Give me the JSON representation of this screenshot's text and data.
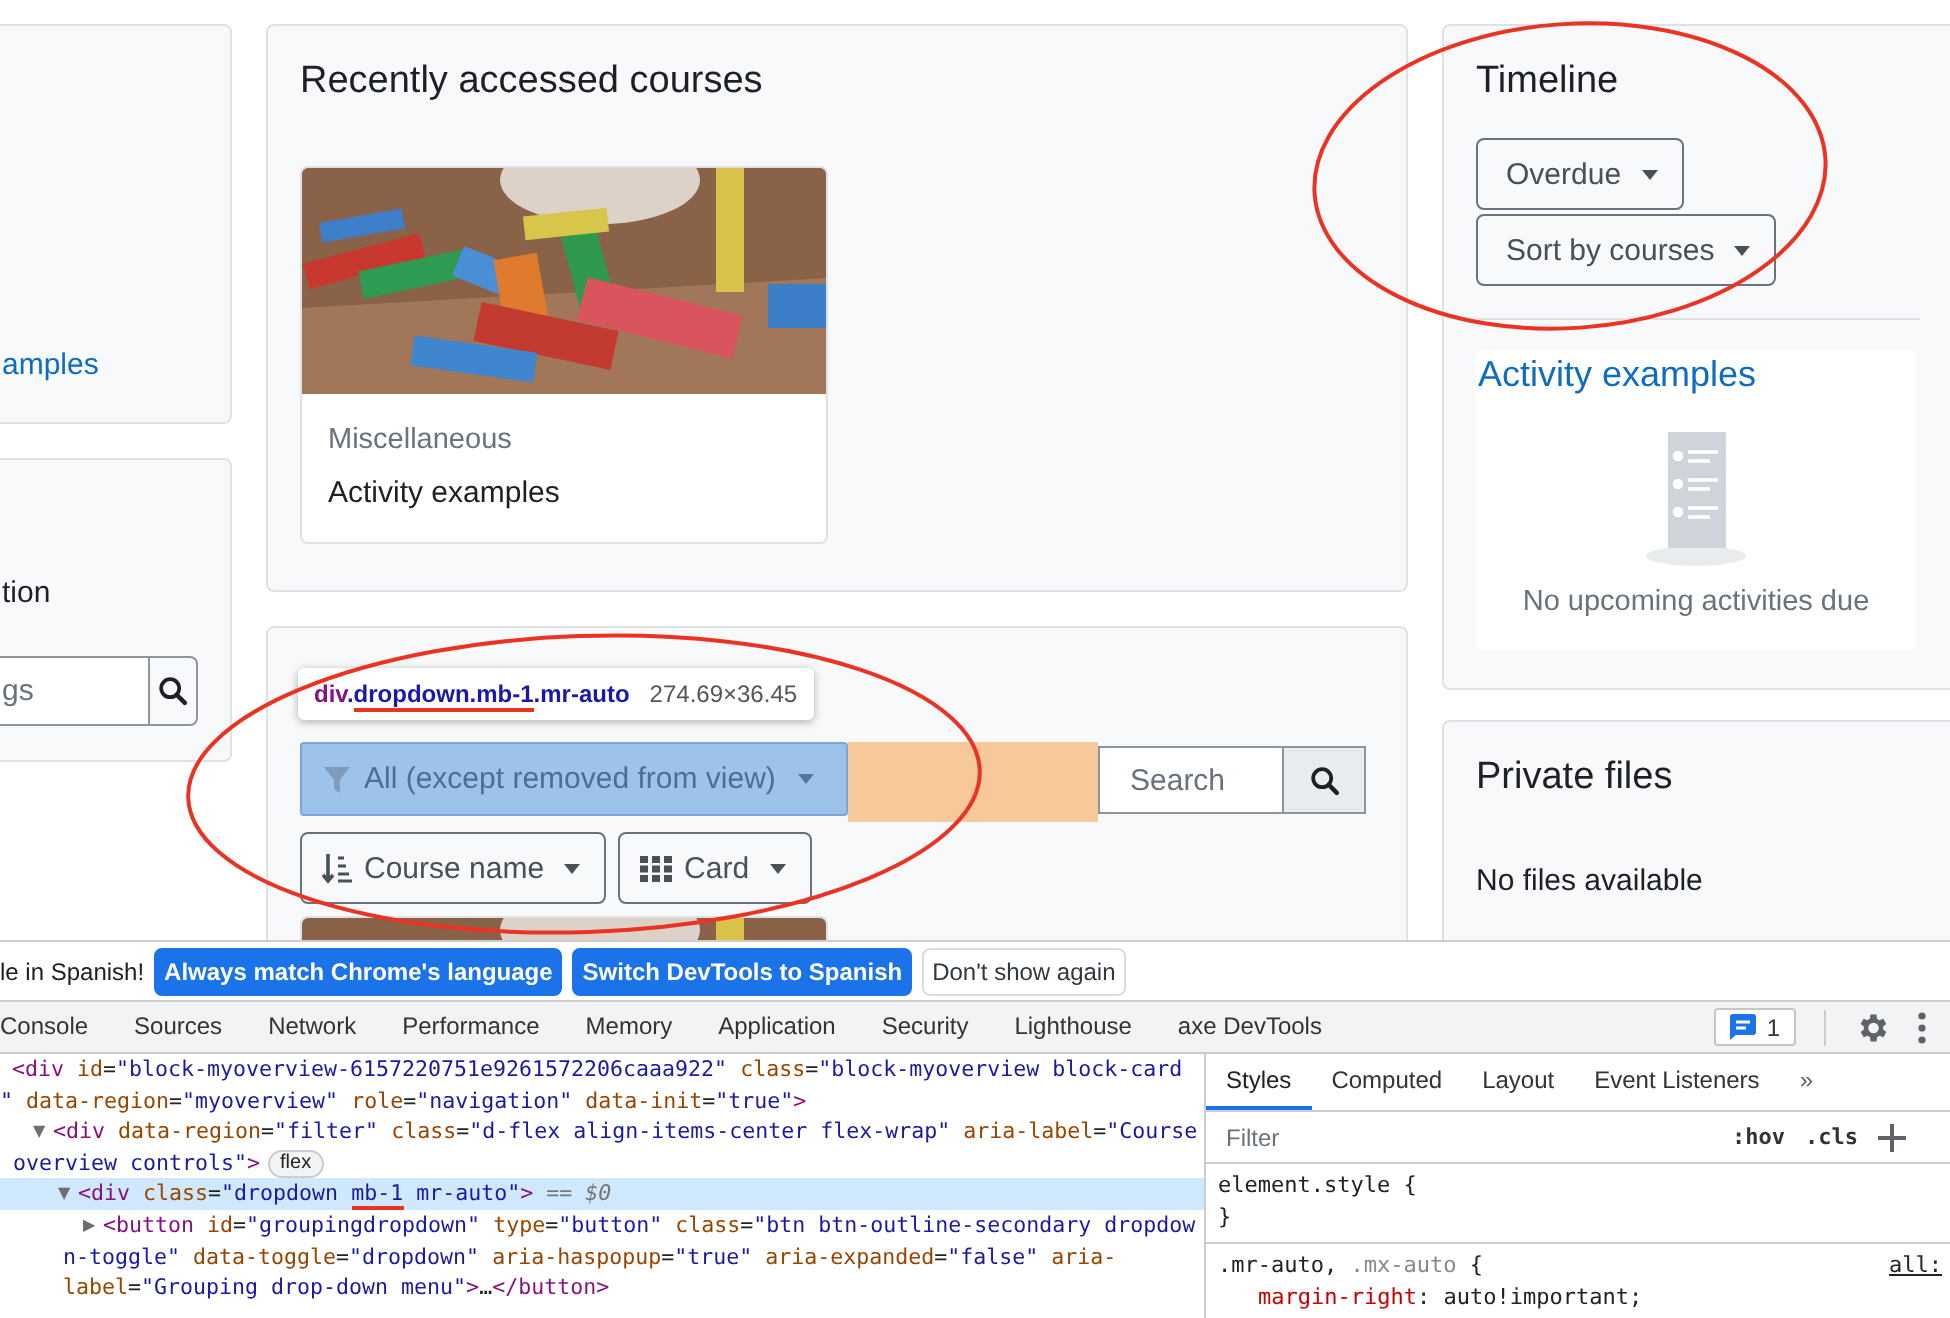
{
  "left_column": {
    "link": "amples",
    "label": "tion",
    "search": {
      "placeholder": "gs"
    }
  },
  "recently_accessed": {
    "title": "Recently accessed courses",
    "courses": [
      {
        "category": "Miscellaneous",
        "name": "Activity examples"
      }
    ]
  },
  "course_overview": {
    "tooltip": {
      "segments": [
        {
          "kind": "tag",
          "text": "div"
        },
        {
          "kind": "class",
          "text": "."
        },
        {
          "kind": "underlined",
          "text": "dropdown.mb-1"
        },
        {
          "kind": "class",
          "text": ".mr-auto"
        }
      ],
      "size": "274.69×36.45"
    },
    "grouping": "All (except removed from view)",
    "search": {
      "placeholder": "Search"
    },
    "sort": "Course name",
    "view": "Card"
  },
  "timeline": {
    "title": "Timeline",
    "filter": "Overdue",
    "sort": "Sort by courses",
    "course": "Activity examples",
    "empty": "No upcoming activities due"
  },
  "private_files": {
    "title": "Private files",
    "empty": "No files available"
  },
  "devtools": {
    "infobar": {
      "message": "le in Spanish!",
      "buttons": [
        {
          "label": "Always match Chrome's language",
          "kind": "primary"
        },
        {
          "label": "Switch DevTools to Spanish",
          "kind": "primary"
        },
        {
          "label": "Don't show again",
          "kind": "secondary"
        }
      ]
    },
    "tabs": [
      {
        "label": "Console",
        "selected": false
      },
      {
        "label": "Sources",
        "selected": false
      },
      {
        "label": "Network",
        "selected": false
      },
      {
        "label": "Performance",
        "selected": false
      },
      {
        "label": "Memory",
        "selected": false
      },
      {
        "label": "Application",
        "selected": false
      },
      {
        "label": "Security",
        "selected": false
      },
      {
        "label": "Lighthouse",
        "selected": false
      },
      {
        "label": "axe DevTools",
        "selected": false
      }
    ],
    "issues_count": "1",
    "dom_tree": [
      {
        "selected": false,
        "lines": [
          [
            {
              "kind": "tag",
              "text": "<div"
            },
            {
              "kind": "attr",
              "text": " id"
            },
            {
              "kind": "plain",
              "text": "="
            },
            {
              "kind": "value",
              "text": "\"block-myoverview-6157220751e9261572206caaa922\""
            },
            {
              "kind": "attr",
              "text": " class"
            },
            {
              "kind": "plain",
              "text": "="
            },
            {
              "kind": "value",
              "text": "\"block-myoverview block-card"
            }
          ],
          [
            {
              "kind": "value",
              "text": "\""
            },
            {
              "kind": "attr",
              "text": " data-region"
            },
            {
              "kind": "plain",
              "text": "="
            },
            {
              "kind": "value",
              "text": "\"myoverview\""
            },
            {
              "kind": "attr",
              "text": " role"
            },
            {
              "kind": "plain",
              "text": "="
            },
            {
              "kind": "value",
              "text": "\"navigation\""
            },
            {
              "kind": "attr",
              "text": " data-init"
            },
            {
              "kind": "plain",
              "text": "="
            },
            {
              "kind": "value",
              "text": "\"true\""
            },
            {
              "kind": "tag",
              "text": ">"
            }
          ]
        ],
        "children": [
          {
            "toggle": "▼",
            "selected": false,
            "badge": "flex",
            "lines": [
              [
                {
                  "kind": "tag",
                  "text": "<div"
                },
                {
                  "kind": "attr",
                  "text": " data-region"
                },
                {
                  "kind": "plain",
                  "text": "="
                },
                {
                  "kind": "value",
                  "text": "\"filter\""
                },
                {
                  "kind": "attr",
                  "text": " class"
                },
                {
                  "kind": "plain",
                  "text": "="
                },
                {
                  "kind": "value",
                  "text": "\"d-flex align-items-center flex-wrap\""
                },
                {
                  "kind": "attr",
                  "text": " aria-label"
                },
                {
                  "kind": "plain",
                  "text": "="
                },
                {
                  "kind": "value",
                  "text": "\"Course"
                }
              ],
              [
                {
                  "kind": "value",
                  "text": "overview controls\""
                },
                {
                  "kind": "tag",
                  "text": ">"
                }
              ]
            ],
            "children": [
              {
                "toggle": "▼",
                "selected": true,
                "lines": [
                  [
                    {
                      "kind": "tag",
                      "text": "<div"
                    },
                    {
                      "kind": "attr",
                      "text": " class"
                    },
                    {
                      "kind": "plain",
                      "text": "="
                    },
                    {
                      "kind": "value",
                      "text": "\"dropdown "
                    },
                    {
                      "kind": "underlined",
                      "text": "mb-1"
                    },
                    {
                      "kind": "value",
                      "text": " mr-auto\""
                    },
                    {
                      "kind": "tag",
                      "text": ">"
                    },
                    {
                      "kind": "dim",
                      "text": " == $0"
                    }
                  ]
                ],
                "children": [
                  {
                    "toggle": "▶",
                    "selected": false,
                    "lines": [
                      [
                        {
                          "kind": "tag",
                          "text": "<button"
                        },
                        {
                          "kind": "attr",
                          "text": " id"
                        },
                        {
                          "kind": "plain",
                          "text": "="
                        },
                        {
                          "kind": "value",
                          "text": "\"groupingdropdown\""
                        },
                        {
                          "kind": "attr",
                          "text": " type"
                        },
                        {
                          "kind": "plain",
                          "text": "="
                        },
                        {
                          "kind": "value",
                          "text": "\"button\""
                        },
                        {
                          "kind": "attr",
                          "text": " class"
                        },
                        {
                          "kind": "plain",
                          "text": "="
                        },
                        {
                          "kind": "value",
                          "text": "\"btn btn-outline-secondary dropdow"
                        }
                      ],
                      [
                        {
                          "kind": "value",
                          "text": "n-toggle\""
                        },
                        {
                          "kind": "attr",
                          "text": " data-toggle"
                        },
                        {
                          "kind": "plain",
                          "text": "="
                        },
                        {
                          "kind": "value",
                          "text": "\"dropdown\""
                        },
                        {
                          "kind": "attr",
                          "text": " aria-haspopup"
                        },
                        {
                          "kind": "plain",
                          "text": "="
                        },
                        {
                          "kind": "value",
                          "text": "\"true\""
                        },
                        {
                          "kind": "attr",
                          "text": " aria-expanded"
                        },
                        {
                          "kind": "plain",
                          "text": "="
                        },
                        {
                          "kind": "value",
                          "text": "\"false\""
                        },
                        {
                          "kind": "attr",
                          "text": " aria-"
                        }
                      ],
                      [
                        {
                          "kind": "attr",
                          "text": "label"
                        },
                        {
                          "kind": "plain",
                          "text": "="
                        },
                        {
                          "kind": "value",
                          "text": "\"Grouping drop-down menu\""
                        },
                        {
                          "kind": "tag",
                          "text": ">"
                        },
                        {
                          "kind": "plain",
                          "text": "…"
                        },
                        {
                          "kind": "tag",
                          "text": "</button>"
                        }
                      ]
                    ]
                  }
                ]
              }
            ]
          }
        ]
      }
    ],
    "styles": {
      "tabs": [
        {
          "label": "Styles",
          "selected": true
        },
        {
          "label": "Computed",
          "selected": false
        },
        {
          "label": "Layout",
          "selected": false
        },
        {
          "label": "Event Listeners",
          "selected": false
        }
      ],
      "more_tabs": "»",
      "filter": {
        "placeholder": "Filter"
      },
      "toggles": [
        ":hov",
        ".cls"
      ],
      "rules": [
        {
          "selector_line": [
            {
              "kind": "selector",
              "text": "element.style"
            },
            {
              "kind": "plain",
              "text": " {"
            }
          ],
          "close": "}"
        },
        {
          "source": "all:",
          "selector_line": [
            {
              "kind": "selector",
              "text": ".mr-auto"
            },
            {
              "kind": "plain",
              "text": ", "
            },
            {
              "kind": "faded",
              "text": ".mx-auto"
            },
            {
              "kind": "plain",
              "text": " {"
            }
          ],
          "declarations": [
            [
              {
                "kind": "property",
                "text": "margin-right"
              },
              {
                "kind": "plain",
                "text": ": auto!important;"
              }
            ]
          ]
        }
      ]
    }
  }
}
